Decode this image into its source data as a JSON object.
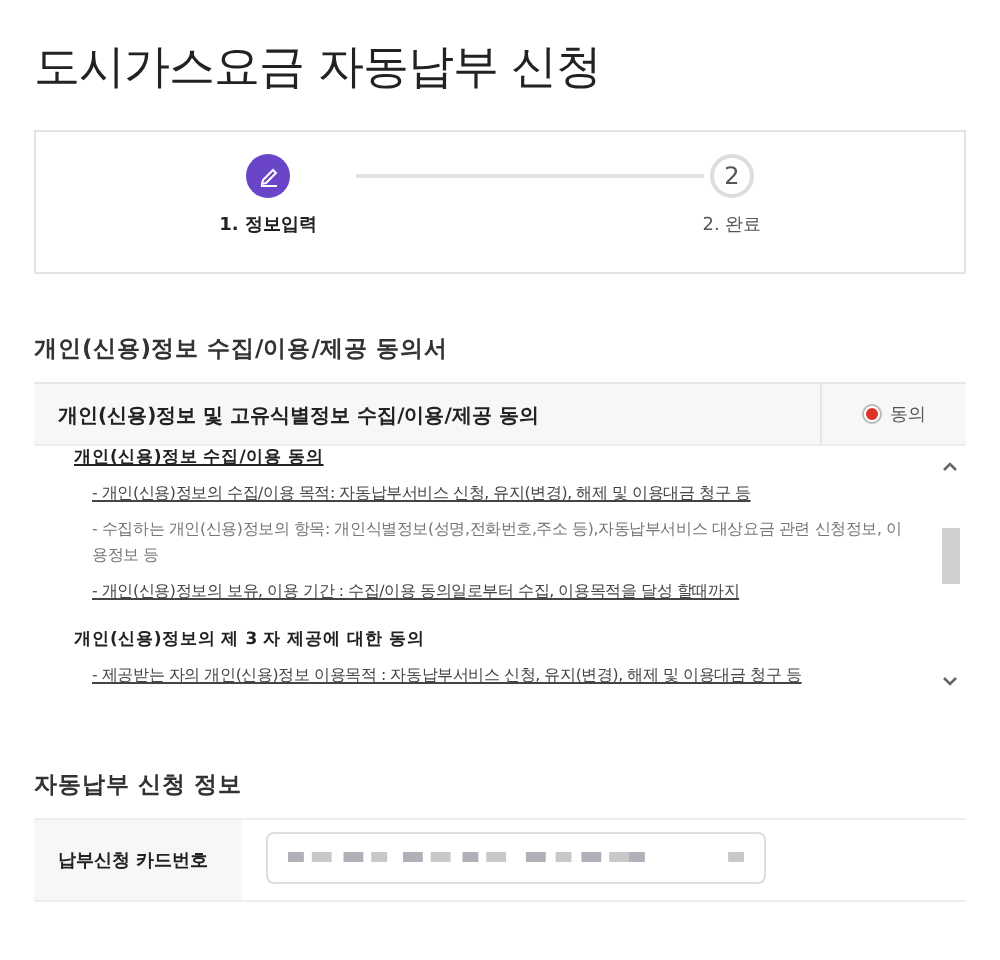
{
  "title": "도시가스요금 자동납부 신청",
  "steps": [
    {
      "label": "1. 정보입력",
      "selected": true
    },
    {
      "number": "2",
      "label": "2. 완료",
      "selected": false
    }
  ],
  "consent_section": {
    "heading": "개인(신용)정보 수집/이용/제공 동의서",
    "header": {
      "label": "개인(신용)정보 및 고유식별정보 수집/이용/제공 동의",
      "radio_label": "동의",
      "checked": true
    },
    "body": [
      {
        "kind": "heading",
        "text": "개인(신용)정보 수집/이용 동의"
      },
      {
        "kind": "bullet",
        "emphasis": true,
        "text": "- 개인(신용)정보의 수집/이용 목적: 자동납부서비스 신청, 유지(변경), 해제 및 이용대금 청구 등"
      },
      {
        "kind": "bullet",
        "emphasis": false,
        "text": "- 수집하는 개인(신용)정보의 항목: 개인식별정보(성명,전화번호,주소 등),자동납부서비스 대상요금 관련 신청정보, 이용정보 등"
      },
      {
        "kind": "bullet",
        "emphasis": true,
        "text": "- 개인(신용)정보의 보유, 이용 기간 : 수집/이용 동의일로부터 수집, 이용목적을 달성 할때까지"
      },
      {
        "kind": "heading",
        "text": "개인(신용)정보의 제 3 자 제공에 대한 동의"
      },
      {
        "kind": "bullet",
        "emphasis": true,
        "text": "- 제공받는 자의 개인(신용)정보 이용목적 : 자동납부서비스 신청, 유지(변경), 해제 및 이용대금 청구 등"
      }
    ]
  },
  "application_section": {
    "heading": "자동납부 신청 정보",
    "fields": [
      {
        "label": "납부신청 카드번호"
      }
    ]
  }
}
